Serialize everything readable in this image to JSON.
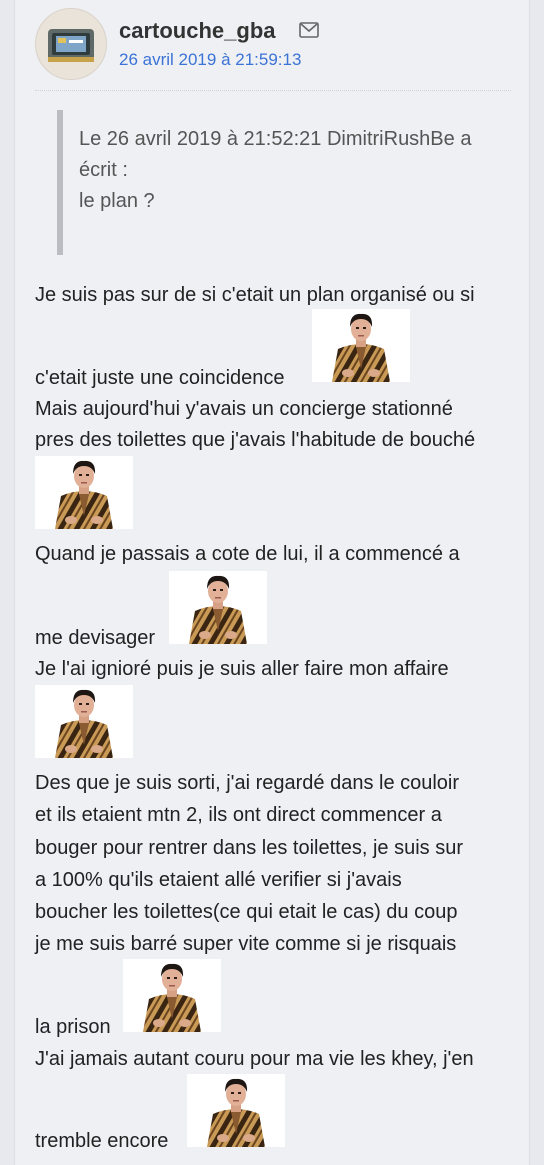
{
  "post": {
    "author": "cartouche_gba",
    "date": "26 avril 2019 à 21:59:13",
    "quote": {
      "header": "Le 26 avril 2019 à 21:52:21 DimitriRushBe a écrit :",
      "text": "le plan ?"
    },
    "lines": {
      "l1": "Je suis pas sur de si c'etait un plan organisé ou si",
      "l2": "c'etait juste une coincidence",
      "l3": "Mais aujourd'hui y'avais un concierge stationné",
      "l4": "pres des toilettes que j'avais l'habitude de bouché",
      "l5": "Quand je passais a cote de lui, il a commencé a",
      "l6": "me devisager",
      "l7": "Je l'ai ignioré puis je suis aller faire mon affaire",
      "l8": "Des que je suis sorti, j'ai regardé dans le couloir",
      "l9": "et ils etaient mtn 2, ils ont direct commencer a",
      "l10": "bouger pour rentrer dans les toilettes, je suis sur",
      "l11": "a 100% qu'ils etaient allé verifier si j'avais",
      "l12": "boucher les toilettes(ce qui etait le cas) du coup",
      "l13": "je me suis barré super vite comme si je risquais",
      "l14": "la prison",
      "l15": "J'ai jamais autant couru pour ma vie les khey, j'en",
      "l16": "tremble encore"
    }
  },
  "icons": {
    "mail": "envelope-icon",
    "sticker": "sticker-man-tiger-jacket"
  },
  "colors": {
    "date_link": "#3b73d6",
    "quote_bar": "#b9bcc1",
    "background": "#eef0f4"
  }
}
